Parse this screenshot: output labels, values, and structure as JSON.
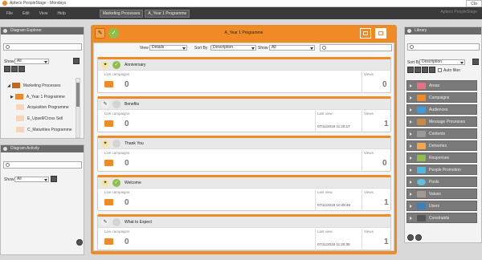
{
  "titlebar": {
    "title": "Apteco PeopleStage - Mondays",
    "close_label": "Clo"
  },
  "menubar": {
    "items": [
      "File",
      "Edit",
      "View",
      "Help"
    ],
    "crumbs": [
      "Marketing Processes",
      "A_Year 1 Programme"
    ],
    "right_text": "Apteco PeopleStage"
  },
  "left_panel": {
    "header": "Diagram Explorer",
    "show_label": "Show",
    "show_value": "All",
    "tree": [
      {
        "label": "Marketing Processes",
        "color": "#c6681a"
      },
      {
        "label": "A_Year 1 Programme",
        "color": "#f08a24"
      },
      {
        "label": "Acquisition Programme",
        "color": "#f6d5b8"
      },
      {
        "label": "E_Upsell/Cross Sell",
        "color": "#f6d5b8"
      },
      {
        "label": "C_Maturities Programme",
        "color": "#f6d5b8"
      }
    ]
  },
  "left_panel2": {
    "header": "Diagram Activity",
    "show_label": "Show",
    "show_value": "All"
  },
  "main": {
    "title": "A_Year 1 Programme",
    "view_label": "View",
    "view_value": "Details",
    "sort_label": "Sort By",
    "sort_value": "Description",
    "show_label": "Show",
    "show_value": "All",
    "cards": [
      {
        "name": "Anniversary",
        "status": "approved",
        "live_label": "Live campaigns",
        "live": "0",
        "last_view_label": "",
        "last_view": "",
        "views_label": "Views",
        "views": "0"
      },
      {
        "name": "Benefits",
        "status": "edit",
        "live_label": "Live campaigns",
        "live": "0",
        "last_view_label": "Last view",
        "last_view": "07/11/2018 11:20:17",
        "views_label": "Views",
        "views": "1"
      },
      {
        "name": "Thank You",
        "status": "none",
        "live_label": "Live campaigns",
        "live": "0",
        "last_view_label": "",
        "last_view": "",
        "views_label": "Views",
        "views": "0"
      },
      {
        "name": "Welcome",
        "status": "approved",
        "live_label": "Live campaigns",
        "live": "0",
        "last_view_label": "Last view",
        "last_view": "07/11/2018 10:45:46",
        "views_label": "Views",
        "views": "1"
      },
      {
        "name": "What to Expect",
        "status": "edit",
        "live_label": "Live campaigns",
        "live": "0",
        "last_view_label": "Last view",
        "last_view": "07/11/2018 11:20:38",
        "views_label": "Views",
        "views": "1"
      }
    ]
  },
  "library": {
    "header": "Library",
    "sort_label": "Sort By",
    "sort_value": "Description",
    "auto_filter_label": "Auto filter",
    "items": [
      {
        "label": "Areas",
        "color": "#e8717f"
      },
      {
        "label": "Campaigns",
        "color": "#f08a24"
      },
      {
        "label": "Audiences",
        "color": "#3f9be0"
      },
      {
        "label": "Message Processes",
        "color": "#c88a44"
      },
      {
        "label": "Contents",
        "color": "#9a9a9a"
      },
      {
        "label": "Deliveries",
        "color": "#f6a64a"
      },
      {
        "label": "Responses",
        "color": "#8cc04b"
      },
      {
        "label": "People Promotion",
        "color": "#4eb8e0"
      },
      {
        "label": "Pools",
        "color": "#5fc0e0"
      },
      {
        "label": "Values",
        "color": "#a59a90"
      },
      {
        "label": "Users",
        "color": "#3a7fc0"
      },
      {
        "label": "Constraints",
        "color": "#555555"
      }
    ]
  }
}
